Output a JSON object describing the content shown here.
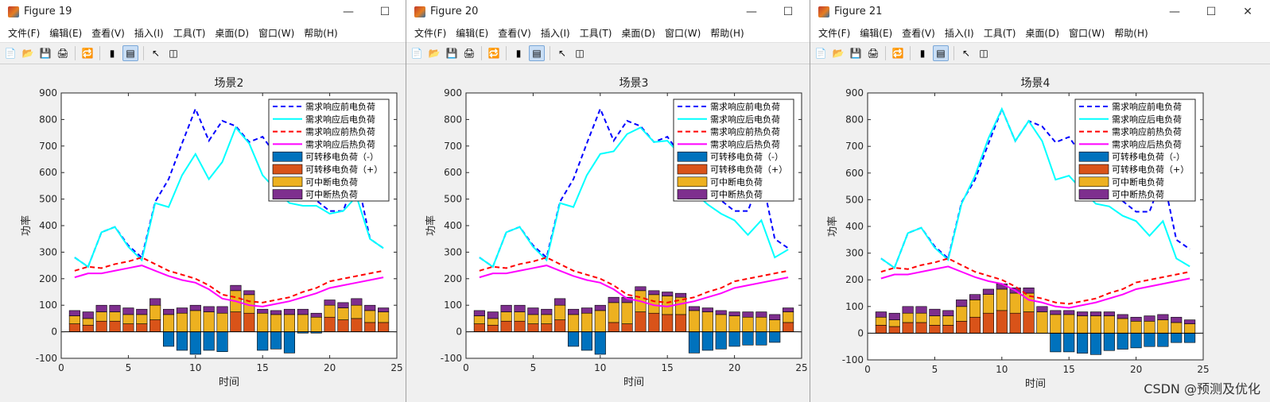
{
  "menu": [
    "文件(F)",
    "编辑(E)",
    "查看(V)",
    "插入(I)",
    "工具(T)",
    "桌面(D)",
    "窗口(W)",
    "帮助(H)"
  ],
  "watermark": "CSDN @预测及优化",
  "colors": {
    "pre_elec": "#0000ff",
    "post_elec": "#00ffff",
    "pre_heat": "#ff0000",
    "post_heat": "#ff00ff",
    "shift_neg": "#0072bd",
    "shift_pos": "#d95319",
    "interrupt_elec": "#edb120",
    "interrupt_heat": "#7e2f8e"
  },
  "windows": [
    {
      "title": "Figure 19",
      "chart_data": {
        "type": "line",
        "title": "场景2",
        "xlabel": "时间",
        "ylabel": "功率",
        "xlim": [
          0,
          25
        ],
        "ylim": [
          -100,
          900
        ],
        "xticks": [
          0,
          5,
          10,
          15,
          20,
          25
        ],
        "yticks": [
          -100,
          0,
          100,
          200,
          300,
          400,
          500,
          600,
          700,
          800,
          900
        ],
        "legend_position": "top-right",
        "legend": [
          "需求响应前电负荷",
          "需求响应后电负荷",
          "需求响应前热负荷",
          "需求响应后热负荷",
          "可转移电负荷（-）",
          "可转移电负荷（+）",
          "可中断电负荷",
          "可中断热负荷"
        ],
        "x": [
          1,
          2,
          3,
          4,
          5,
          6,
          7,
          8,
          9,
          10,
          11,
          12,
          13,
          14,
          15,
          16,
          17,
          18,
          19,
          20,
          21,
          22,
          23,
          24
        ],
        "pre_elec": [
          280,
          245,
          375,
          395,
          325,
          280,
          490,
          575,
          710,
          840,
          720,
          795,
          775,
          715,
          735,
          665,
          615,
          545,
          495,
          455,
          455,
          590,
          350,
          315
        ],
        "post_elec": [
          280,
          245,
          375,
          395,
          320,
          270,
          485,
          470,
          590,
          670,
          575,
          640,
          770,
          710,
          590,
          535,
          485,
          475,
          475,
          445,
          455,
          510,
          350,
          315
        ],
        "pre_heat": [
          230,
          245,
          240,
          255,
          265,
          280,
          255,
          230,
          215,
          200,
          175,
          140,
          130,
          115,
          110,
          120,
          130,
          150,
          165,
          190,
          200,
          210,
          220,
          230
        ],
        "post_heat": [
          205,
          220,
          220,
          230,
          240,
          250,
          230,
          210,
          195,
          185,
          160,
          125,
          115,
          100,
          95,
          105,
          115,
          130,
          145,
          165,
          175,
          185,
          195,
          205
        ],
        "shift_neg": [
          0,
          0,
          0,
          0,
          0,
          0,
          0,
          -55,
          -70,
          -85,
          -70,
          -75,
          0,
          0,
          -70,
          -65,
          -80,
          -5,
          -5,
          0,
          0,
          0,
          0,
          0
        ],
        "shift_pos": [
          30,
          25,
          40,
          40,
          30,
          30,
          45,
          0,
          0,
          0,
          0,
          0,
          75,
          70,
          0,
          0,
          0,
          0,
          0,
          55,
          45,
          50,
          35,
          35
        ],
        "interrupt_elec": [
          30,
          25,
          35,
          35,
          35,
          35,
          55,
          65,
          70,
          80,
          75,
          70,
          80,
          70,
          70,
          65,
          65,
          65,
          55,
          45,
          45,
          50,
          45,
          40
        ],
        "interrupt_heat": [
          20,
          25,
          25,
          25,
          25,
          20,
          25,
          20,
          20,
          20,
          20,
          25,
          20,
          15,
          15,
          15,
          20,
          20,
          15,
          20,
          20,
          25,
          20,
          15
        ]
      }
    },
    {
      "title": "Figure 20",
      "chart_data": {
        "type": "line",
        "title": "场景3",
        "xlabel": "时间",
        "ylabel": "功率",
        "xlim": [
          0,
          25
        ],
        "ylim": [
          -100,
          900
        ],
        "xticks": [
          0,
          5,
          10,
          15,
          20,
          25
        ],
        "yticks": [
          -100,
          0,
          100,
          200,
          300,
          400,
          500,
          600,
          700,
          800,
          900
        ],
        "legend_position": "top-right",
        "legend": [
          "需求响应前电负荷",
          "需求响应后电负荷",
          "需求响应前热负荷",
          "需求响应后热负荷",
          "可转移电负荷（-）",
          "可转移电负荷（+）",
          "可中断电负荷",
          "可中断热负荷"
        ],
        "x": [
          1,
          2,
          3,
          4,
          5,
          6,
          7,
          8,
          9,
          10,
          11,
          12,
          13,
          14,
          15,
          16,
          17,
          18,
          19,
          20,
          21,
          22,
          23,
          24
        ],
        "pre_elec": [
          280,
          245,
          375,
          395,
          325,
          280,
          490,
          575,
          710,
          840,
          720,
          795,
          775,
          715,
          735,
          665,
          615,
          545,
          495,
          455,
          455,
          590,
          350,
          315
        ],
        "post_elec": [
          280,
          245,
          375,
          395,
          320,
          270,
          485,
          470,
          590,
          670,
          680,
          745,
          770,
          715,
          720,
          665,
          525,
          480,
          445,
          420,
          365,
          420,
          280,
          310
        ],
        "pre_heat": [
          230,
          245,
          240,
          255,
          265,
          280,
          255,
          230,
          215,
          200,
          175,
          140,
          130,
          115,
          110,
          120,
          130,
          150,
          165,
          190,
          200,
          210,
          220,
          230
        ],
        "post_heat": [
          205,
          220,
          220,
          230,
          240,
          250,
          230,
          210,
          195,
          185,
          160,
          125,
          115,
          100,
          95,
          105,
          115,
          130,
          145,
          165,
          175,
          185,
          195,
          205
        ],
        "shift_neg": [
          0,
          0,
          0,
          0,
          0,
          0,
          0,
          -55,
          -70,
          -85,
          0,
          0,
          0,
          0,
          0,
          0,
          -80,
          -70,
          -65,
          -55,
          -50,
          -50,
          -40,
          0
        ],
        "shift_pos": [
          30,
          25,
          40,
          40,
          30,
          30,
          45,
          0,
          0,
          0,
          35,
          30,
          75,
          70,
          65,
          65,
          0,
          0,
          0,
          0,
          0,
          0,
          0,
          35
        ],
        "interrupt_elec": [
          30,
          25,
          35,
          35,
          35,
          35,
          55,
          65,
          70,
          80,
          75,
          80,
          80,
          70,
          70,
          65,
          80,
          75,
          65,
          60,
          55,
          55,
          45,
          40
        ],
        "interrupt_heat": [
          20,
          25,
          25,
          25,
          25,
          20,
          25,
          20,
          20,
          20,
          20,
          20,
          15,
          15,
          15,
          15,
          15,
          15,
          15,
          15,
          20,
          20,
          20,
          15
        ]
      }
    },
    {
      "title": "Figure 21",
      "chart_data": {
        "type": "line",
        "title": "场景4",
        "xlabel": "时间",
        "ylabel": "功率",
        "xlim": [
          0,
          25
        ],
        "ylim": [
          -100,
          900
        ],
        "xticks": [
          0,
          5,
          10,
          15,
          20,
          25
        ],
        "yticks": [
          -100,
          0,
          100,
          200,
          300,
          400,
          500,
          600,
          700,
          800,
          900
        ],
        "legend_position": "top-right",
        "legend": [
          "需求响应前电负荷",
          "需求响应后电负荷",
          "需求响应前热负荷",
          "需求响应后热负荷",
          "可转移电负荷（-）",
          "可转移电负荷（+）",
          "可中断电负荷",
          "可中断热负荷"
        ],
        "x": [
          1,
          2,
          3,
          4,
          5,
          6,
          7,
          8,
          9,
          10,
          11,
          12,
          13,
          14,
          15,
          16,
          17,
          18,
          19,
          20,
          21,
          22,
          23,
          24
        ],
        "pre_elec": [
          280,
          245,
          375,
          395,
          325,
          280,
          490,
          575,
          710,
          840,
          720,
          795,
          775,
          715,
          735,
          665,
          615,
          545,
          495,
          455,
          455,
          590,
          350,
          315
        ],
        "post_elec": [
          280,
          245,
          375,
          395,
          320,
          275,
          485,
          590,
          730,
          840,
          720,
          795,
          720,
          575,
          590,
          535,
          485,
          475,
          440,
          420,
          365,
          420,
          280,
          250
        ],
        "pre_heat": [
          230,
          245,
          240,
          255,
          265,
          280,
          255,
          230,
          215,
          200,
          175,
          140,
          130,
          115,
          110,
          120,
          130,
          150,
          165,
          190,
          200,
          210,
          220,
          230
        ],
        "post_heat": [
          205,
          220,
          220,
          230,
          240,
          250,
          230,
          210,
          195,
          185,
          160,
          125,
          115,
          100,
          95,
          105,
          115,
          130,
          145,
          165,
          175,
          185,
          195,
          205
        ],
        "shift_neg": [
          0,
          0,
          0,
          0,
          0,
          0,
          0,
          0,
          0,
          0,
          0,
          0,
          0,
          -70,
          -70,
          -75,
          -80,
          -65,
          -60,
          -55,
          -50,
          -50,
          -35,
          -35
        ],
        "shift_pos": [
          30,
          25,
          40,
          40,
          30,
          30,
          45,
          60,
          75,
          85,
          75,
          80,
          0,
          0,
          0,
          0,
          0,
          0,
          0,
          0,
          0,
          0,
          0,
          0
        ],
        "interrupt_elec": [
          30,
          25,
          35,
          35,
          35,
          35,
          55,
          65,
          70,
          80,
          75,
          70,
          80,
          70,
          70,
          65,
          65,
          65,
          55,
          45,
          45,
          50,
          40,
          35
        ],
        "interrupt_heat": [
          20,
          25,
          25,
          25,
          25,
          20,
          25,
          20,
          20,
          20,
          20,
          20,
          20,
          15,
          15,
          15,
          15,
          15,
          15,
          15,
          20,
          20,
          20,
          15
        ]
      }
    }
  ]
}
